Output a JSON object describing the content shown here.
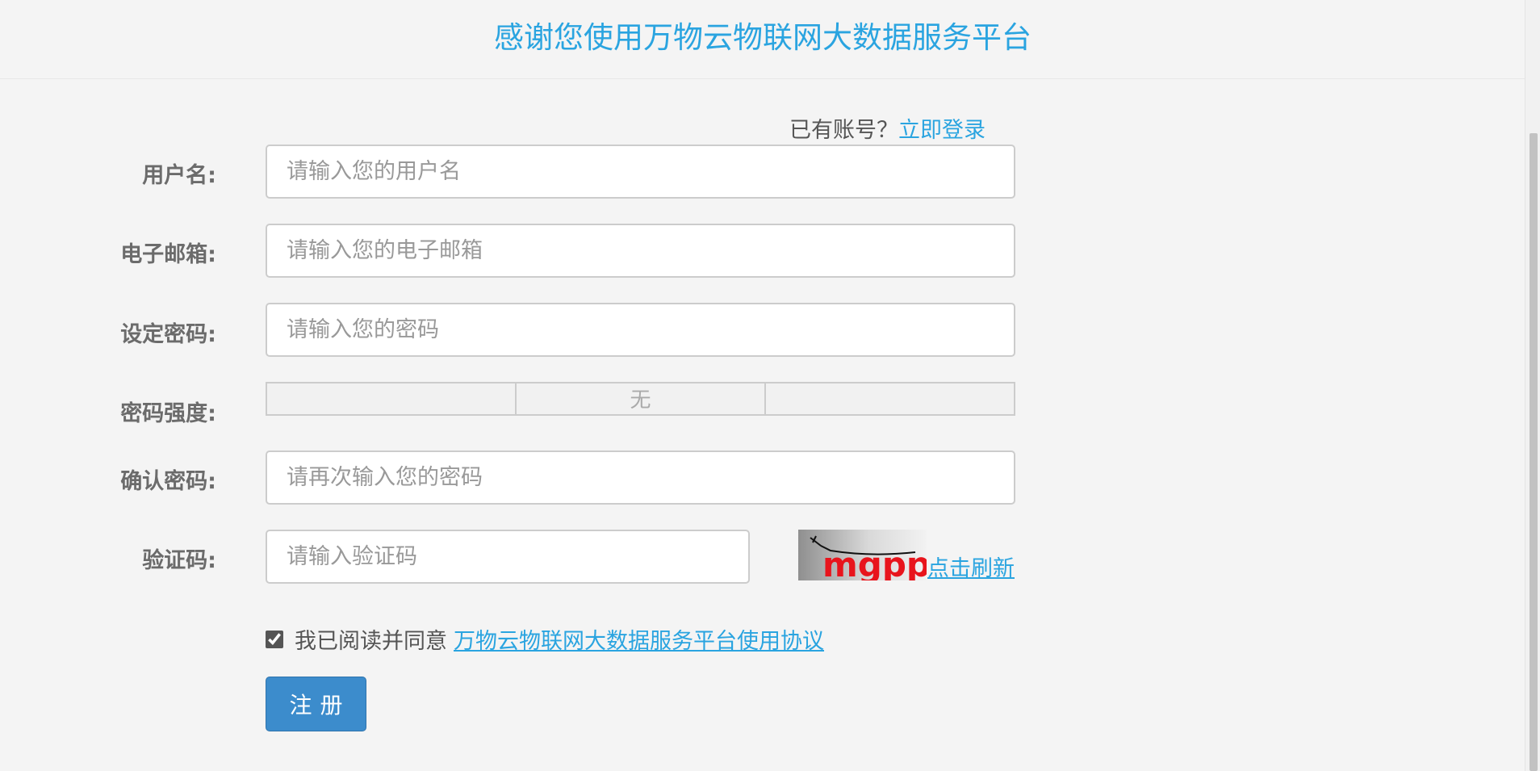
{
  "header": {
    "title": "感谢您使用万物云物联网大数据服务平台"
  },
  "login_prompt": {
    "text": "已有账号？",
    "link": "立即登录"
  },
  "form": {
    "username": {
      "label": "用户名:",
      "placeholder": "请输入您的用户名",
      "value": ""
    },
    "email": {
      "label": "电子邮箱:",
      "placeholder": "请输入您的电子邮箱",
      "value": ""
    },
    "password": {
      "label": "设定密码:",
      "placeholder": "请输入您的密码",
      "value": ""
    },
    "strength": {
      "label": "密码强度:",
      "levels": [
        "",
        "无",
        ""
      ]
    },
    "confirm": {
      "label": "确认密码:",
      "placeholder": "请再次输入您的密码",
      "value": ""
    },
    "captcha": {
      "label": "验证码:",
      "placeholder": "请输入验证码",
      "value": "",
      "image_text": "mgpp",
      "refresh": "点击刷新"
    }
  },
  "agreement": {
    "checked": true,
    "text": "我已阅读并同意",
    "link": "万物云物联网大数据服务平台使用协议"
  },
  "register": {
    "label": "注册"
  },
  "colors": {
    "accent": "#2aa4e0",
    "button": "#3c8ccc",
    "background": "#f4f4f4",
    "captcha_text": "#e8141c"
  }
}
